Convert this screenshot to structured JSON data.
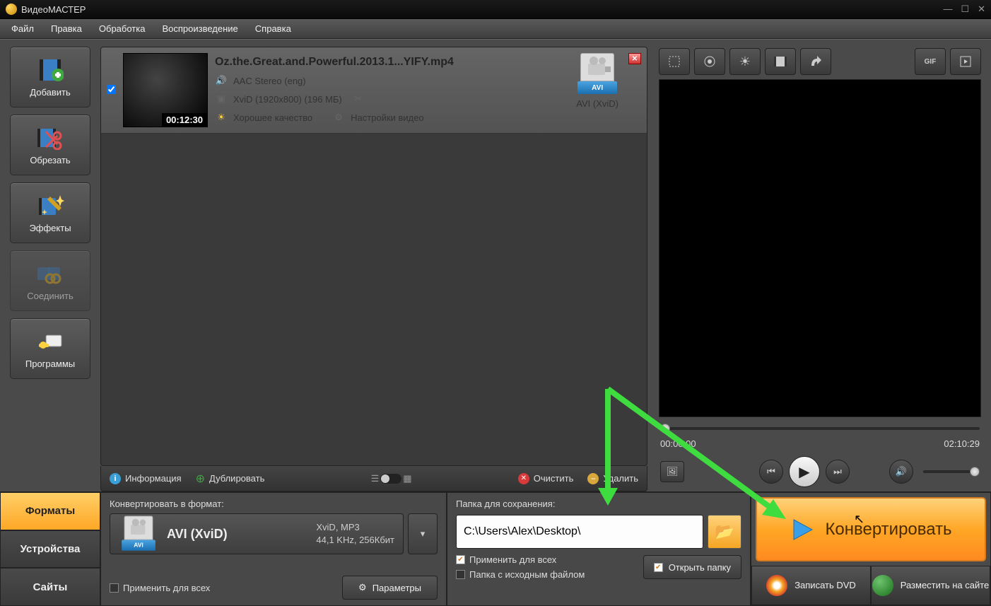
{
  "titlebar": {
    "title": "ВидеоМАСТЕР"
  },
  "menu": {
    "file": "Файл",
    "edit": "Правка",
    "process": "Обработка",
    "playback": "Воспроизведение",
    "help": "Справка"
  },
  "tools": {
    "add": "Добавить",
    "trim": "Обрезать",
    "effects": "Эффекты",
    "join": "Соединить",
    "programs": "Программы"
  },
  "file": {
    "title": "Oz.the.Great.and.Powerful.2013.1...YIFY.mp4",
    "audio": "AAC Stereo (eng)",
    "video": "XviD (1920x800) (196 МБ)",
    "quality": "Хорошее качество",
    "settings": "Настройки видео",
    "duration": "00:12:30",
    "out_format": "AVI (XviD)",
    "out_badge": "AVI"
  },
  "list_toolbar": {
    "info": "Информация",
    "duplicate": "Дублировать",
    "clear": "Очистить",
    "delete": "Удалить"
  },
  "preview": {
    "current": "00:00:00",
    "total": "02:10:29"
  },
  "tabs": {
    "formats": "Форматы",
    "devices": "Устройства",
    "sites": "Сайты"
  },
  "format_panel": {
    "label": "Конвертировать в формат:",
    "name": "AVI (XviD)",
    "badge": "AVI",
    "detail1": "XviD, MP3",
    "detail2": "44,1 KHz, 256Кбит",
    "apply_all": "Применить для всех",
    "params": "Параметры"
  },
  "save_panel": {
    "label": "Папка для сохранения:",
    "path": "C:\\Users\\Alex\\Desktop\\",
    "apply_all": "Применить для всех",
    "source_folder": "Папка с исходным файлом",
    "open_folder": "Открыть папку"
  },
  "convert": {
    "button": "Конвертировать",
    "dvd": "Записать DVD",
    "publish": "Разместить на сайте"
  }
}
